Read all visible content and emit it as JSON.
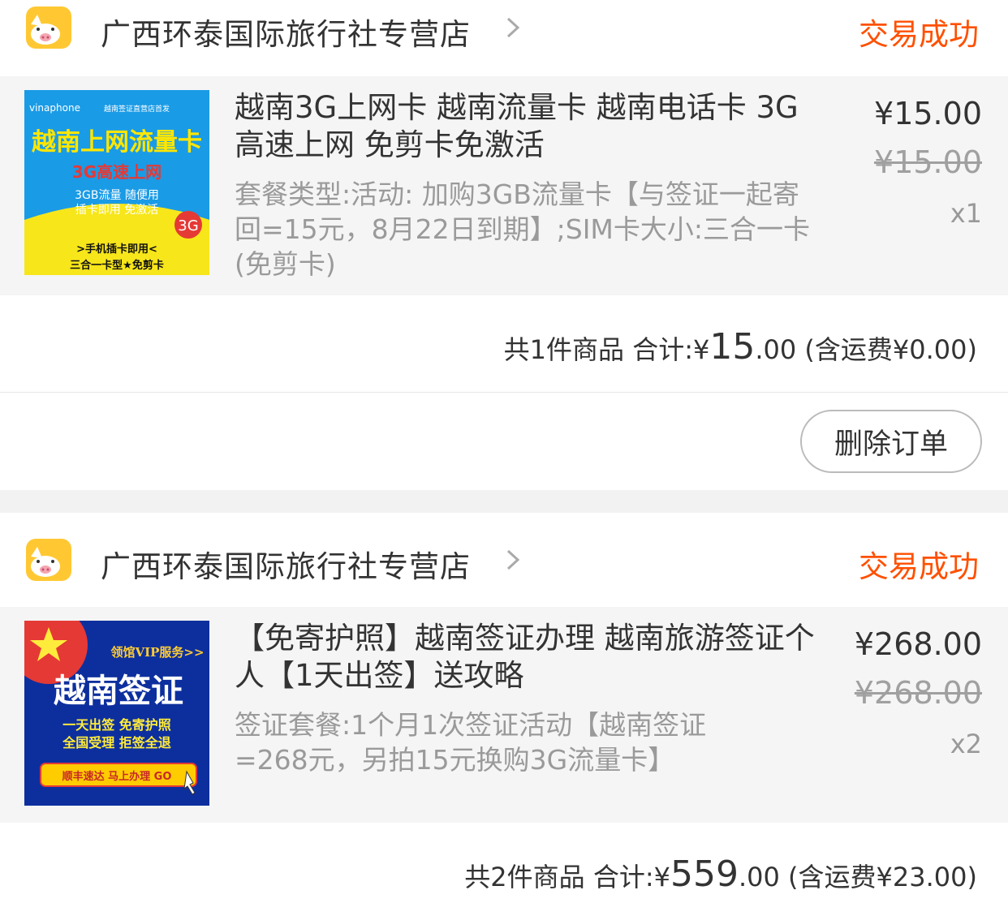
{
  "orders": [
    {
      "shop_name": "广西环泰国际旅行社专营店",
      "status": "交易成功",
      "item": {
        "title": "越南3G上网卡 越南流量卡  越南电话卡 3G高速上网 免剪卡免激活",
        "sku": "套餐类型:活动:  加购3GB流量卡【与签证一起寄回=15元，8月22日到期】;SIM卡大小:三合一卡(免剪卡)",
        "price": "¥15.00",
        "original_price": "¥15.00",
        "quantity": "x1",
        "thumb": {
          "brand": "vinaphone",
          "tagline": "越南签证直营店首发",
          "headline": "越南上网流量卡",
          "sub": "3G高速上网",
          "line1": "3GB流量 随便用",
          "line2": "插卡即用 免激活",
          "badge": "3G",
          "bottom1": ">手机插卡即用<",
          "bottom2": "三合一卡型★免剪卡"
        }
      },
      "summary": {
        "count_label": "共1件商品",
        "total_label": "合计:",
        "currency": "¥",
        "total_int": "15",
        "total_dec": ".00",
        "shipping": "(含运费¥0.00)"
      },
      "delete_label": "删除订单"
    },
    {
      "shop_name": "广西环泰国际旅行社专营店",
      "status": "交易成功",
      "item": {
        "title": "【免寄护照】越南签证办理 越南旅游签证个人【1天出签】送攻略",
        "sku": "签证套餐:1个月1次签证活动【越南签证=268元，另拍15元换购3G流量卡】",
        "price": "¥268.00",
        "original_price": "¥268.00",
        "quantity": "x2",
        "thumb": {
          "vip": "领馆VIP服务>>",
          "headline": "越南签证",
          "line1": "一天出签 免寄护照",
          "line2": "全国受理 拒签全退",
          "cta": "顺丰速达 马上办理 GO"
        }
      },
      "summary": {
        "count_label": "共2件商品",
        "total_label": "合计:",
        "currency": "¥",
        "total_int": "559",
        "total_dec": ".00",
        "shipping": "(含运费¥23.00)"
      }
    }
  ],
  "colors": {
    "status": "#ff5000",
    "logo_bg": "#ffc833",
    "item_bg": "#f5f5f5"
  }
}
